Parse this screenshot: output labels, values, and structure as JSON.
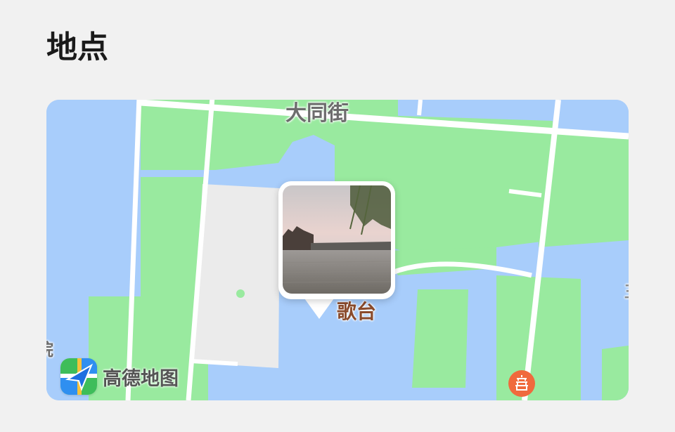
{
  "section": {
    "title": "地点"
  },
  "map": {
    "street_label": "大同街",
    "poi_label": "歌台",
    "left_edge_label": "院",
    "right_edge_label": "王",
    "provider": {
      "name": "高德地图",
      "logo_icon": "amap-logo-icon"
    },
    "photo_pin": {
      "icon": "photo-thumbnail-icon"
    },
    "poi_marker": {
      "icon": "pagoda-marker-icon",
      "color": "#f06a3d"
    },
    "colors": {
      "water": "#a8cdfb",
      "land": "#99ea9f",
      "road": "#ffffff",
      "building": "#ebebeb"
    }
  }
}
